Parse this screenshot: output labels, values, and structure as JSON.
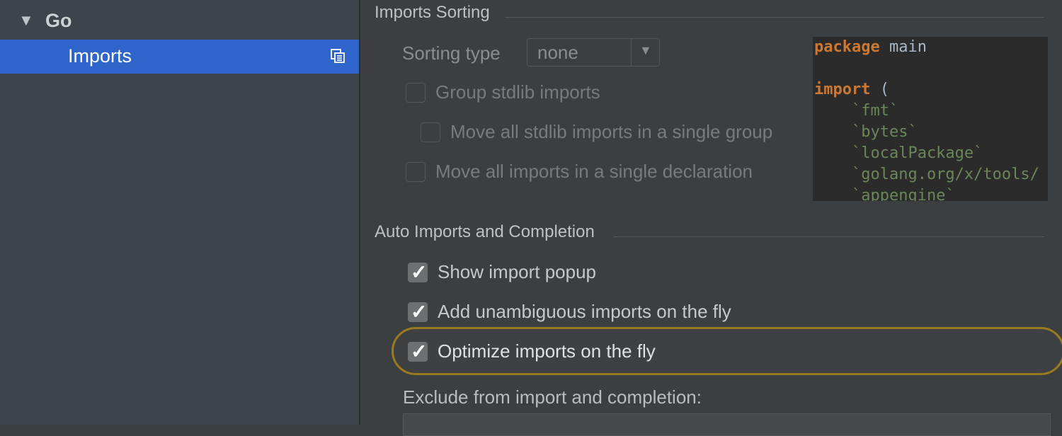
{
  "sidebar": {
    "go_node": {
      "arrow": "▼",
      "label": "Go"
    },
    "imports_node": {
      "label": "Imports",
      "icon": "copy-settings-icon"
    }
  },
  "imports_sorting": {
    "section_title": "Imports Sorting",
    "sorting_type_label": "Sorting type",
    "sorting_type_value": "none",
    "options": [
      {
        "label": "Group stdlib imports",
        "checked": false,
        "enabled": false
      },
      {
        "label": "Move all stdlib imports in a single group",
        "checked": false,
        "enabled": false
      },
      {
        "label": "Move all imports in a single declaration",
        "checked": false,
        "enabled": false
      }
    ]
  },
  "code_preview": {
    "lines": [
      {
        "kw": "package",
        "rest": " main"
      },
      {
        "kw": "",
        "rest": ""
      },
      {
        "kw": "import",
        "rest": " ("
      },
      {
        "str": "    `fmt`"
      },
      {
        "str": "    `bytes`"
      },
      {
        "str": "    `localPackage`"
      },
      {
        "str": "    `golang.org/x/tools/"
      },
      {
        "str": "    `appengine`"
      }
    ]
  },
  "auto_imports": {
    "section_title": "Auto Imports and Completion",
    "options": [
      {
        "label": "Show import popup",
        "checked": true
      },
      {
        "label": "Add unambiguous imports on the fly",
        "checked": true
      },
      {
        "label": "Optimize imports on the fly",
        "checked": true,
        "highlighted": true
      }
    ],
    "exclude_label": "Exclude from import and completion:"
  },
  "colors": {
    "selection": "#2f65ca",
    "highlight_ring": "#9a7a1f",
    "keyword": "#cc7832",
    "string": "#6a8759"
  }
}
